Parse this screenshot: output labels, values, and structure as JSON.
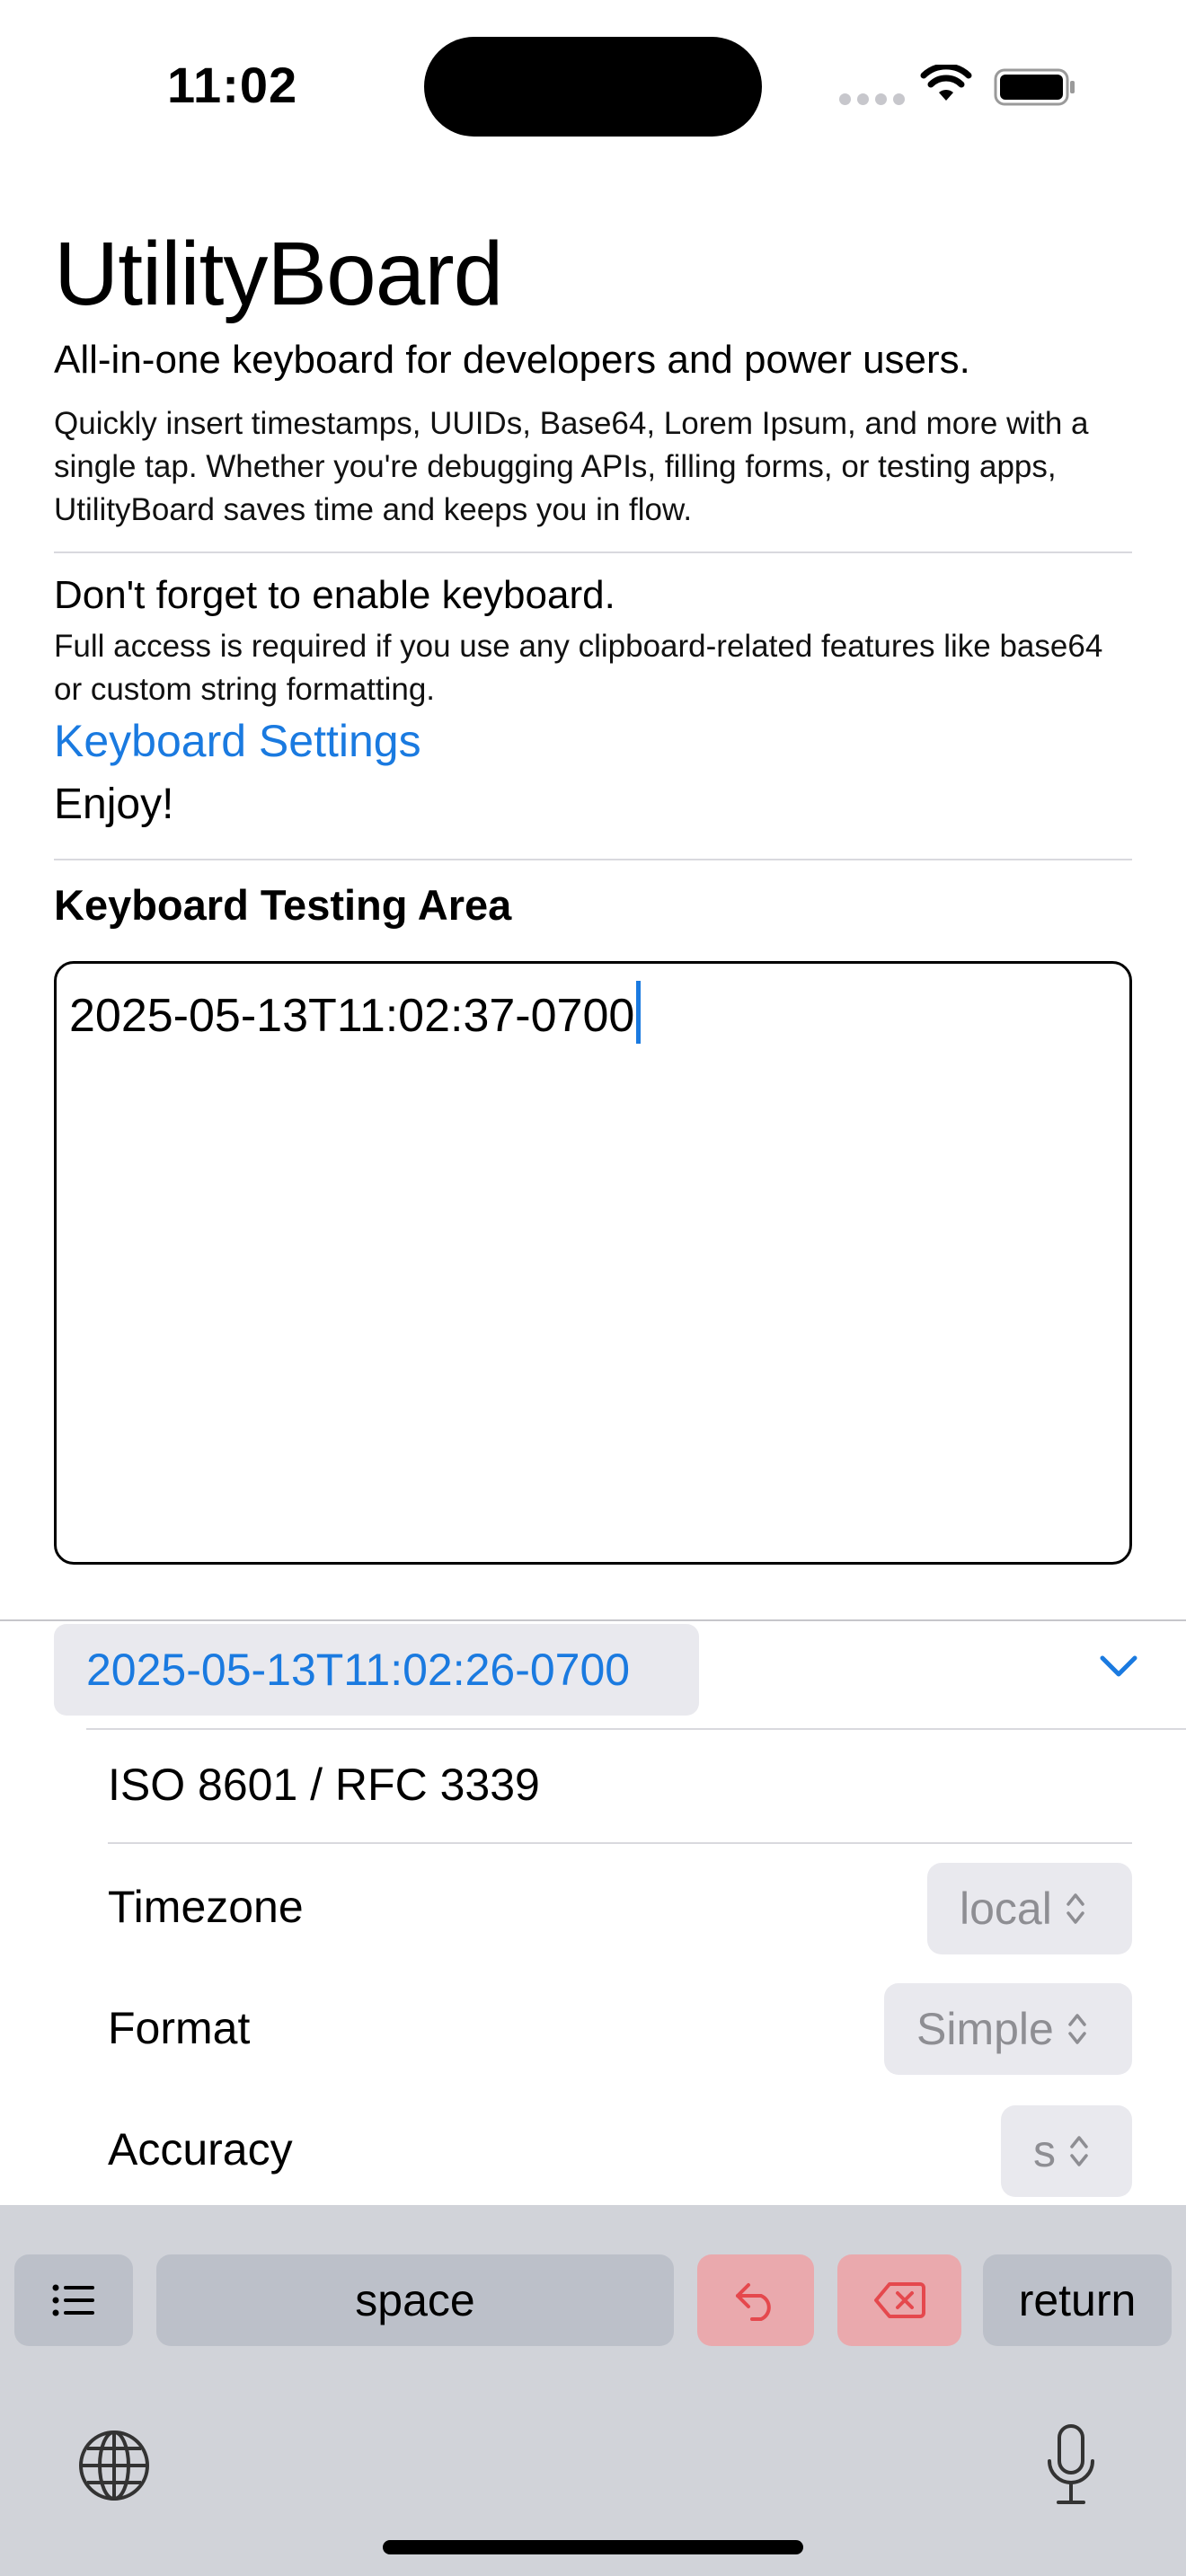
{
  "status_bar": {
    "time": "11:02"
  },
  "header": {
    "title": "UtilityBoard",
    "subtitle": "All-in-one keyboard for developers and power users.",
    "description": "Quickly insert timestamps, UUIDs, Base64, Lorem Ipsum, and more with a single tap. Whether you're debugging APIs, filling forms, or testing apps, UtilityBoard saves time and keeps you in flow."
  },
  "setup": {
    "reminder": "Don't forget to enable keyboard.",
    "access_note": "Full access is required if you use any clipboard-related features like base64 or custom string formatting.",
    "settings_link": "Keyboard Settings",
    "enjoy": "Enjoy!"
  },
  "testing": {
    "section_title": "Keyboard Testing Area",
    "text": "2025-05-13T11:02:37-0700"
  },
  "keyboard": {
    "preview_value": "2025-05-13T11:02:26-0700",
    "format_name": "ISO 8601 / RFC 3339",
    "options": [
      {
        "label": "Timezone",
        "value": "local"
      },
      {
        "label": "Format",
        "value": "Simple"
      },
      {
        "label": "Accuracy",
        "value": "s"
      }
    ],
    "keys": {
      "menu_icon": "list-icon",
      "space": "space",
      "undo_icon": "undo-arrow-icon",
      "delete_icon": "delete-backward-icon",
      "return": "return"
    },
    "accent_color": "#1a7ae0",
    "danger_color": "#e5484d"
  }
}
